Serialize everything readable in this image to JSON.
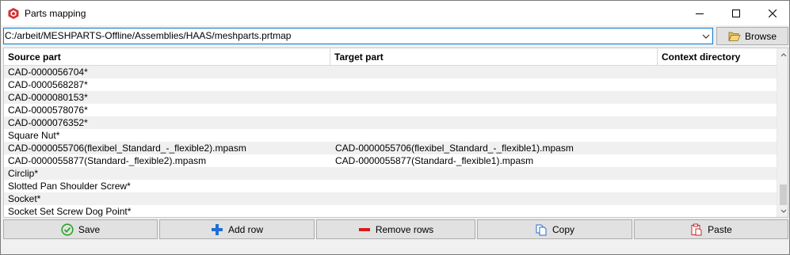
{
  "window": {
    "title": "Parts mapping",
    "icon": "meshparts-app-icon",
    "controls": [
      "minimize-icon",
      "maximize-icon",
      "close-icon"
    ]
  },
  "path_bar": {
    "value": "C:/arbeit/MESHPARTS-Offline/Assemblies/HAAS/meshparts.prtmap",
    "browse_label": "Browse",
    "browse_icon": "folder-open-icon"
  },
  "grid": {
    "columns": [
      "Source part",
      "Target part",
      "Context directory"
    ],
    "rows": [
      {
        "source": "CAD-0000056704*",
        "target": "",
        "context": ""
      },
      {
        "source": "CAD-0000568287*",
        "target": "",
        "context": ""
      },
      {
        "source": "CAD-0000080153*",
        "target": "",
        "context": ""
      },
      {
        "source": "CAD-0000578076*",
        "target": "",
        "context": ""
      },
      {
        "source": "CAD-0000076352*",
        "target": "",
        "context": ""
      },
      {
        "source": "Square Nut*",
        "target": "",
        "context": ""
      },
      {
        "source": "CAD-0000055706(flexibel_Standard_-_flexible2).mpasm",
        "target": "CAD-0000055706(flexibel_Standard_-_flexible1).mpasm",
        "context": ""
      },
      {
        "source": "CAD-0000055877(Standard-_flexible2).mpasm",
        "target": "CAD-0000055877(Standard-_flexible1).mpasm",
        "context": ""
      },
      {
        "source": "Circlip*",
        "target": "",
        "context": ""
      },
      {
        "source": "Slotted Pan Shoulder Screw*",
        "target": "",
        "context": ""
      },
      {
        "source": "Socket*",
        "target": "",
        "context": ""
      },
      {
        "source": "Socket Set Screw Dog Point*",
        "target": "",
        "context": ""
      }
    ]
  },
  "actions": {
    "save": {
      "label": "Save",
      "icon": "check-circle-icon"
    },
    "add_row": {
      "label": "Add row",
      "icon": "plus-icon"
    },
    "remove_rows": {
      "label": "Remove rows",
      "icon": "minus-icon"
    },
    "copy": {
      "label": "Copy",
      "icon": "copy-icon"
    },
    "paste": {
      "label": "Paste",
      "icon": "paste-icon"
    }
  },
  "colors": {
    "accent_border": "#0078d7",
    "save_green": "#2aa52a",
    "add_blue": "#1f6fd0",
    "remove_red": "#d91a1a",
    "copy_blue": "#2b6cc4",
    "paste_red": "#c62828"
  }
}
